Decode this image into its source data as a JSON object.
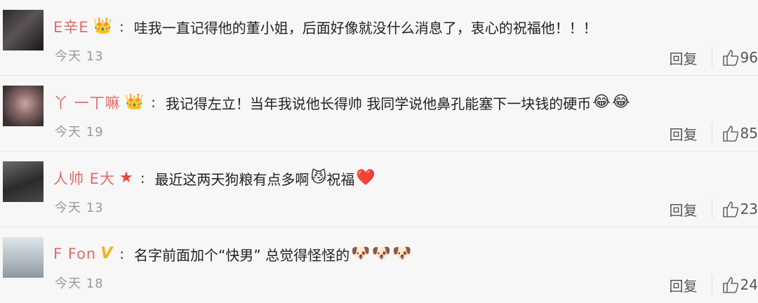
{
  "reply_label": "回复",
  "comments": [
    {
      "username": "E辛E",
      "badge": "👑",
      "badge_icon": "crown-icon",
      "colon": ":",
      "text": "哇我一直记得他的董小姐，后面好像就没什么消息了，衷心的祝福他！！！",
      "time": "今天 13",
      "likes": "96",
      "emojis": []
    },
    {
      "username": "丫 一丅嘛",
      "badge": "👑",
      "badge_icon": "crown-icon",
      "colon": ":",
      "text": "我记得左立！当年我说他长得帅 我同学说他鼻孔能塞下一块钱的硬币",
      "time": "今天 19",
      "likes": "85",
      "emojis": [
        "😂",
        "😂"
      ]
    },
    {
      "username": "人帅 E大",
      "badge": "★",
      "badge_icon": "star-icon",
      "colon": ":",
      "text": "最近这两天狗粮有点多啊",
      "text2": "祝福",
      "time": "今天 13",
      "likes": "23",
      "emoji_mid": "😼",
      "emoji_end": "❤️"
    },
    {
      "username": "F Fon",
      "badge": "V",
      "badge_icon": "verified-v-icon",
      "colon": ":",
      "text": "名字前面加个“快男” 总觉得怪怪的",
      "time": "今天 18",
      "likes": "24",
      "emojis": [
        "🐶",
        "🐶",
        "🐶"
      ]
    }
  ]
}
